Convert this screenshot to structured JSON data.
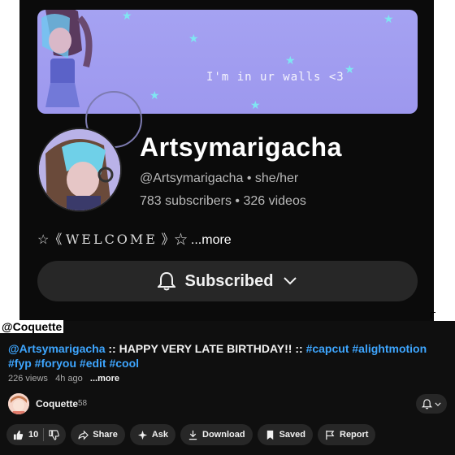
{
  "video": {
    "banner_text": "I'm in ur walls <3",
    "channel_name": "Artsymarigacha",
    "handle": "@Artsymarigacha",
    "pronouns": "she/her",
    "subscribers": "783 subscribers",
    "videos": "326 videos",
    "welcome_prefix": "☆《",
    "welcome_word": "WELCOME",
    "welcome_suffix": "》☆",
    "welcome_more": "...more",
    "subscribed_label": "Subscribed",
    "watermark": "@Coquette"
  },
  "info": {
    "title_mention": "@Artsymarigacha",
    "title_text": " :: HAPPY VERY LATE BIRTHDAY!! :: ",
    "title_tags": "#capcut #alightmotion #fyp #foryou #edit #cool",
    "views": "226 views",
    "time": "4h ago",
    "more": "...more",
    "channel_name": "Coquette",
    "channel_subs": "58"
  },
  "actions": {
    "likes": "10",
    "share": "Share",
    "ask": "Ask",
    "download": "Download",
    "saved": "Saved",
    "report": "Report"
  },
  "colors": {
    "accent_link": "#3ea6ff",
    "banner": "#a5a2f2",
    "pill": "#272727",
    "background": "#0f0f0f"
  },
  "icons": [
    "star-icon",
    "bell-icon",
    "chevron-down-icon",
    "thumbs-up-icon",
    "thumbs-down-icon",
    "share-icon",
    "sparkle-icon",
    "download-icon",
    "bookmark-icon",
    "flag-icon"
  ]
}
